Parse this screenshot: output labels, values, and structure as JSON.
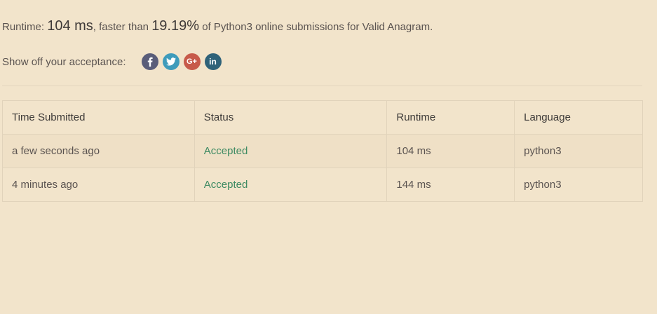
{
  "summary": {
    "runtime_prefix": "Runtime: ",
    "runtime_value": "104 ms",
    "faster_than_text": ", faster than ",
    "percent_value": "19.19%",
    "suffix_text": " of Python3 online submissions for Valid Anagram."
  },
  "share": {
    "label": "Show off your acceptance:",
    "icons": [
      {
        "name": "facebook-icon",
        "glyph": "f",
        "color": "#5a5d79"
      },
      {
        "name": "twitter-icon",
        "glyph": "t",
        "color": "#3e9bbb"
      },
      {
        "name": "google-plus-icon",
        "glyph": "G+",
        "color": "#c75a4a"
      },
      {
        "name": "linkedin-icon",
        "glyph": "in",
        "color": "#2f6279"
      }
    ]
  },
  "table": {
    "headers": [
      "Time Submitted",
      "Status",
      "Runtime",
      "Language"
    ],
    "rows": [
      {
        "time": "a few seconds ago",
        "status": "Accepted",
        "runtime": "104 ms",
        "language": "python3"
      },
      {
        "time": "4 minutes ago",
        "status": "Accepted",
        "runtime": "144 ms",
        "language": "python3"
      }
    ]
  },
  "colors": {
    "background": "#f2e4cb",
    "accepted": "#3d8a62"
  }
}
